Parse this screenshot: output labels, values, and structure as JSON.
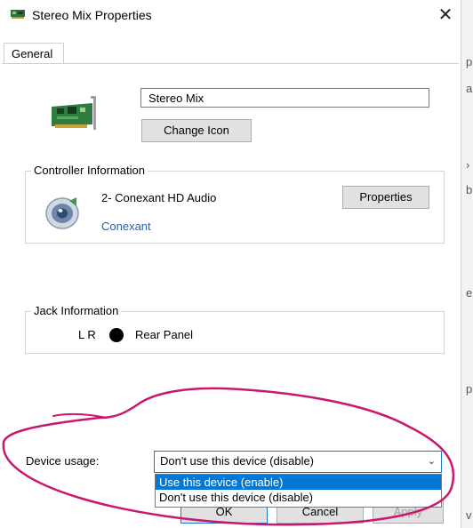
{
  "window": {
    "title": "Stereo Mix Properties",
    "close_glyph": "✕"
  },
  "tabs": [
    {
      "label": "General"
    }
  ],
  "device": {
    "name": "Stereo Mix",
    "change_icon_label": "Change Icon"
  },
  "controller": {
    "legend": "Controller Information",
    "name": "2- Conexant HD Audio",
    "vendor": "Conexant",
    "properties_label": "Properties"
  },
  "jack": {
    "legend": "Jack Information",
    "channels": "L R",
    "panel": "Rear Panel",
    "dot_color": "#000000"
  },
  "device_usage": {
    "label": "Device usage:",
    "selected": "Don't use this device (disable)",
    "options": [
      {
        "label": "Use this device (enable)",
        "highlighted": true
      },
      {
        "label": "Don't use this device (disable)",
        "highlighted": false
      }
    ]
  },
  "buttons": {
    "ok": "OK",
    "cancel": "Cancel",
    "apply": "Apply"
  },
  "colors": {
    "accent": "#0078d7",
    "link": "#2d5fa7",
    "annotation": "#c8186e"
  }
}
